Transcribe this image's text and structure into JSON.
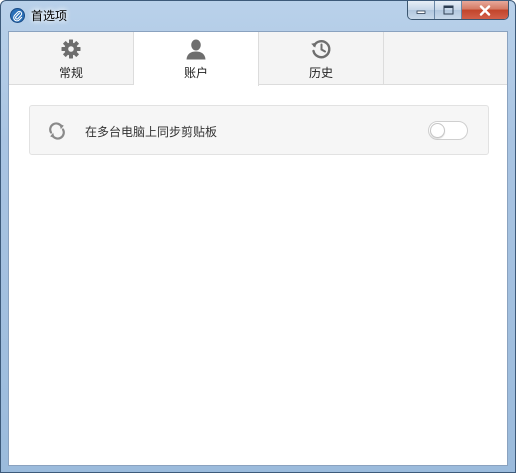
{
  "window": {
    "title": "首选项",
    "app_icon": "paperclip-icon",
    "controls": {
      "minimize_icon": "minimize-icon",
      "maximize_icon": "maximize-icon",
      "close_icon": "close-icon"
    }
  },
  "tabs": [
    {
      "label": "常规",
      "icon": "gear-icon",
      "active": false
    },
    {
      "label": "账户",
      "icon": "user-icon",
      "active": true
    },
    {
      "label": "历史",
      "icon": "history-icon",
      "active": false
    }
  ],
  "settings": [
    {
      "icon": "sync-icon",
      "label": "在多台电脑上同步剪贴板",
      "enabled": false
    }
  ],
  "colors": {
    "titlebar": "#a9c4e2",
    "close_button": "#c2452b",
    "active_tab": "#ffffff",
    "tabbar": "#f4f4f4"
  }
}
